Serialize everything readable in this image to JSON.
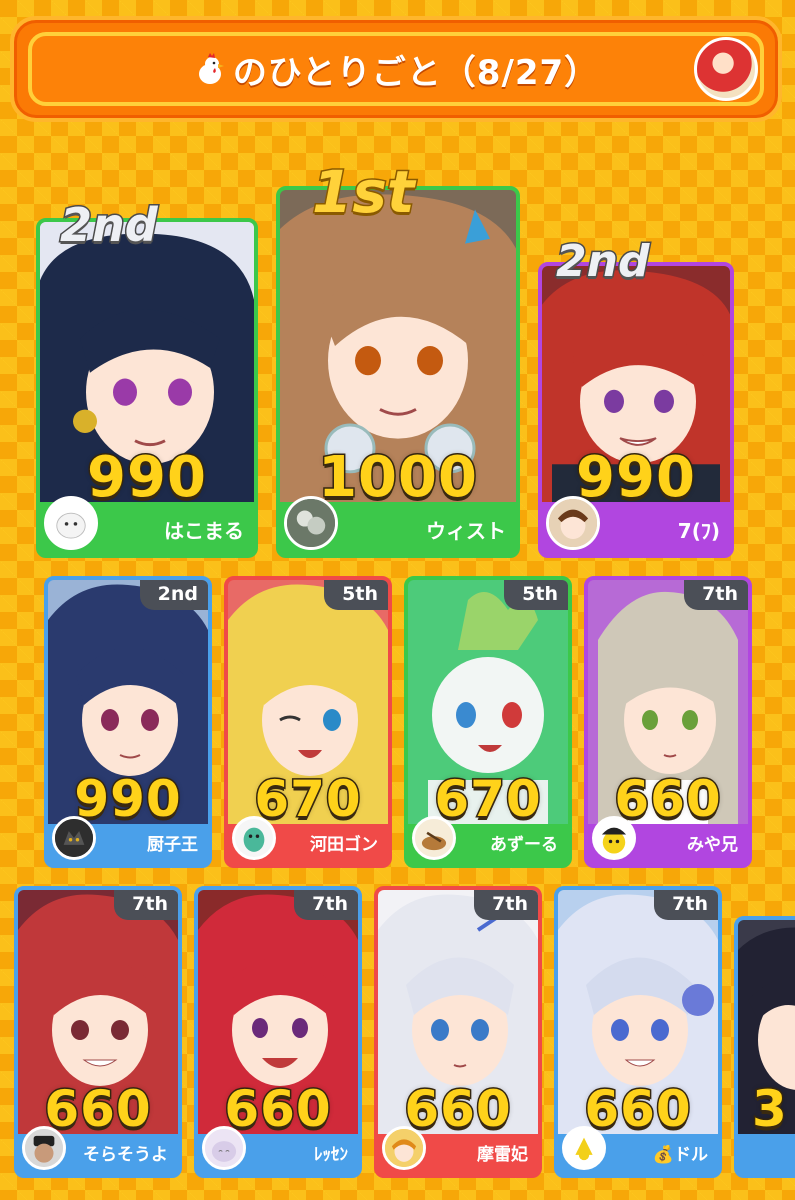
{
  "header": {
    "title": "のひとりごと（8/27）",
    "icon": "chicken-icon",
    "accent": "#fb7a05"
  },
  "podium": [
    {
      "rank": "2nd",
      "score": "990",
      "name": "はこまる",
      "color": "#3cc84a",
      "hair": "#1d2a4a"
    },
    {
      "rank": "1st",
      "score": "1000",
      "name": "ウィスト",
      "color": "#3cc84a",
      "hair": "#b5825a"
    },
    {
      "rank": "2nd",
      "score": "990",
      "name": "7(ﾌ)",
      "color": "#b146e0",
      "hair": "#c0342a"
    }
  ],
  "row2": [
    {
      "rank": "2nd",
      "score": "990",
      "name": "厨子王",
      "color": "#4aa0ea",
      "hair": "#2a3a6e"
    },
    {
      "rank": "5th",
      "score": "670",
      "name": "河田ゴン",
      "color": "#f04a48",
      "hair": "#f0d050"
    },
    {
      "rank": "5th",
      "score": "670",
      "name": "あずーる",
      "color": "#3cc84a",
      "hair": "#9ad46a"
    },
    {
      "rank": "7th",
      "score": "660",
      "name": "みや兄",
      "color": "#b146e0",
      "hair": "#cfc8b8"
    }
  ],
  "row3": [
    {
      "rank": "7th",
      "score": "660",
      "name": "そらそうよ",
      "color": "#4aa0ea",
      "hair": "#c0383a"
    },
    {
      "rank": "7th",
      "score": "660",
      "name": "ﾚｯｾﾝ",
      "color": "#4aa0ea",
      "hair": "#d02a3a"
    },
    {
      "rank": "7th",
      "score": "660",
      "name": "摩雷妃",
      "color": "#f04a48",
      "hair": "#e6e8f0"
    },
    {
      "rank": "7th",
      "score": "660",
      "name": "💰ドル",
      "color": "#4aa0ea",
      "hair": "#dfe4f4"
    },
    {
      "rank": "",
      "score": "3",
      "name": "",
      "color": "#4aa0ea",
      "hair": "#222233"
    }
  ]
}
